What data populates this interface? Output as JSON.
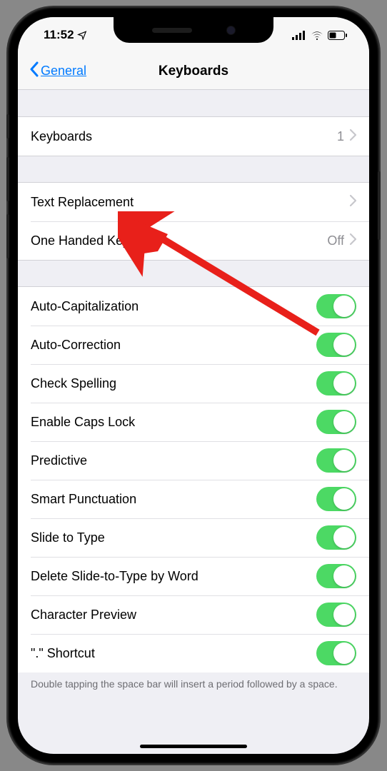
{
  "status": {
    "time": "11:52"
  },
  "nav": {
    "back": "General",
    "title": "Keyboards"
  },
  "sections": {
    "keyboards": {
      "label": "Keyboards",
      "count": "1"
    },
    "text_replacement": {
      "label": "Text Replacement"
    },
    "one_handed": {
      "label": "One Handed Keyboard",
      "value": "Off"
    },
    "toggles": [
      {
        "label": "Auto-Capitalization"
      },
      {
        "label": "Auto-Correction"
      },
      {
        "label": "Check Spelling"
      },
      {
        "label": "Enable Caps Lock"
      },
      {
        "label": "Predictive"
      },
      {
        "label": "Smart Punctuation"
      },
      {
        "label": "Slide to Type"
      },
      {
        "label": "Delete Slide-to-Type by Word"
      },
      {
        "label": "Character Preview"
      },
      {
        "label": "\".\" Shortcut"
      }
    ],
    "footer": "Double tapping the space bar will insert a period followed by a space."
  }
}
